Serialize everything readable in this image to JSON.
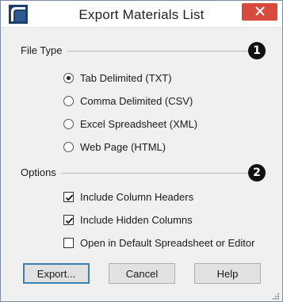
{
  "window": {
    "title": "Export Materials List",
    "accent_close": "#d84a3e",
    "icon": "chief-architect-logo-icon"
  },
  "file_type": {
    "label": "File Type",
    "badge": "1",
    "selected_index": 0,
    "options": [
      "Tab Delimited (TXT)",
      "Comma Delimited (CSV)",
      "Excel Spreadsheet (XML)",
      "Web Page (HTML)"
    ]
  },
  "options": {
    "label": "Options",
    "badge": "2",
    "items": [
      {
        "label": "Include Column Headers",
        "checked": true
      },
      {
        "label": "Include Hidden Columns",
        "checked": true
      },
      {
        "label": "Open in Default Spreadsheet or Editor",
        "checked": false
      }
    ]
  },
  "buttons": {
    "export": "Export...",
    "cancel": "Cancel",
    "help": "Help"
  }
}
